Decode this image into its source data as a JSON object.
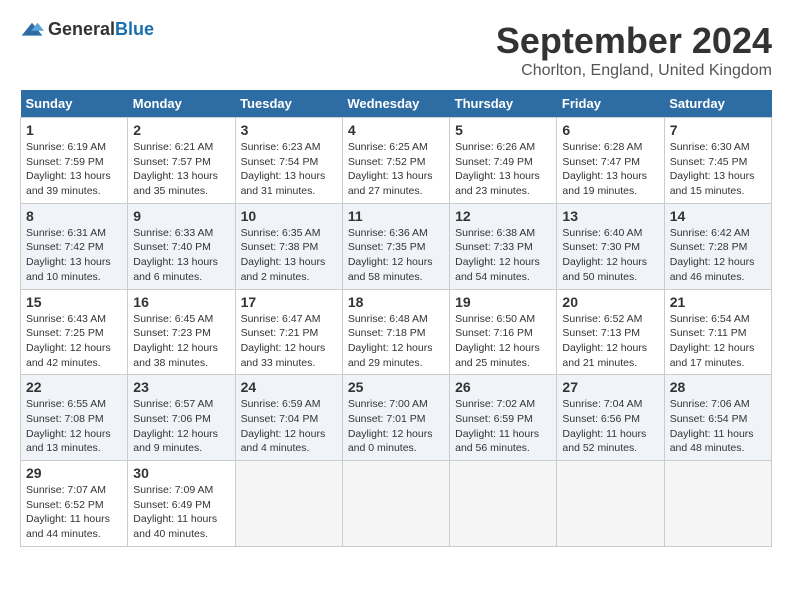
{
  "logo": {
    "general": "General",
    "blue": "Blue"
  },
  "title": "September 2024",
  "location": "Chorlton, England, United Kingdom",
  "headers": [
    "Sunday",
    "Monday",
    "Tuesday",
    "Wednesday",
    "Thursday",
    "Friday",
    "Saturday"
  ],
  "weeks": [
    [
      {
        "day": "1",
        "sunrise": "6:19 AM",
        "sunset": "7:59 PM",
        "daylight": "13 hours and 39 minutes."
      },
      {
        "day": "2",
        "sunrise": "6:21 AM",
        "sunset": "7:57 PM",
        "daylight": "13 hours and 35 minutes."
      },
      {
        "day": "3",
        "sunrise": "6:23 AM",
        "sunset": "7:54 PM",
        "daylight": "13 hours and 31 minutes."
      },
      {
        "day": "4",
        "sunrise": "6:25 AM",
        "sunset": "7:52 PM",
        "daylight": "13 hours and 27 minutes."
      },
      {
        "day": "5",
        "sunrise": "6:26 AM",
        "sunset": "7:49 PM",
        "daylight": "13 hours and 23 minutes."
      },
      {
        "day": "6",
        "sunrise": "6:28 AM",
        "sunset": "7:47 PM",
        "daylight": "13 hours and 19 minutes."
      },
      {
        "day": "7",
        "sunrise": "6:30 AM",
        "sunset": "7:45 PM",
        "daylight": "13 hours and 15 minutes."
      }
    ],
    [
      {
        "day": "8",
        "sunrise": "6:31 AM",
        "sunset": "7:42 PM",
        "daylight": "13 hours and 10 minutes."
      },
      {
        "day": "9",
        "sunrise": "6:33 AM",
        "sunset": "7:40 PM",
        "daylight": "13 hours and 6 minutes."
      },
      {
        "day": "10",
        "sunrise": "6:35 AM",
        "sunset": "7:38 PM",
        "daylight": "13 hours and 2 minutes."
      },
      {
        "day": "11",
        "sunrise": "6:36 AM",
        "sunset": "7:35 PM",
        "daylight": "12 hours and 58 minutes."
      },
      {
        "day": "12",
        "sunrise": "6:38 AM",
        "sunset": "7:33 PM",
        "daylight": "12 hours and 54 minutes."
      },
      {
        "day": "13",
        "sunrise": "6:40 AM",
        "sunset": "7:30 PM",
        "daylight": "12 hours and 50 minutes."
      },
      {
        "day": "14",
        "sunrise": "6:42 AM",
        "sunset": "7:28 PM",
        "daylight": "12 hours and 46 minutes."
      }
    ],
    [
      {
        "day": "15",
        "sunrise": "6:43 AM",
        "sunset": "7:25 PM",
        "daylight": "12 hours and 42 minutes."
      },
      {
        "day": "16",
        "sunrise": "6:45 AM",
        "sunset": "7:23 PM",
        "daylight": "12 hours and 38 minutes."
      },
      {
        "day": "17",
        "sunrise": "6:47 AM",
        "sunset": "7:21 PM",
        "daylight": "12 hours and 33 minutes."
      },
      {
        "day": "18",
        "sunrise": "6:48 AM",
        "sunset": "7:18 PM",
        "daylight": "12 hours and 29 minutes."
      },
      {
        "day": "19",
        "sunrise": "6:50 AM",
        "sunset": "7:16 PM",
        "daylight": "12 hours and 25 minutes."
      },
      {
        "day": "20",
        "sunrise": "6:52 AM",
        "sunset": "7:13 PM",
        "daylight": "12 hours and 21 minutes."
      },
      {
        "day": "21",
        "sunrise": "6:54 AM",
        "sunset": "7:11 PM",
        "daylight": "12 hours and 17 minutes."
      }
    ],
    [
      {
        "day": "22",
        "sunrise": "6:55 AM",
        "sunset": "7:08 PM",
        "daylight": "12 hours and 13 minutes."
      },
      {
        "day": "23",
        "sunrise": "6:57 AM",
        "sunset": "7:06 PM",
        "daylight": "12 hours and 9 minutes."
      },
      {
        "day": "24",
        "sunrise": "6:59 AM",
        "sunset": "7:04 PM",
        "daylight": "12 hours and 4 minutes."
      },
      {
        "day": "25",
        "sunrise": "7:00 AM",
        "sunset": "7:01 PM",
        "daylight": "12 hours and 0 minutes."
      },
      {
        "day": "26",
        "sunrise": "7:02 AM",
        "sunset": "6:59 PM",
        "daylight": "11 hours and 56 minutes."
      },
      {
        "day": "27",
        "sunrise": "7:04 AM",
        "sunset": "6:56 PM",
        "daylight": "11 hours and 52 minutes."
      },
      {
        "day": "28",
        "sunrise": "7:06 AM",
        "sunset": "6:54 PM",
        "daylight": "11 hours and 48 minutes."
      }
    ],
    [
      {
        "day": "29",
        "sunrise": "7:07 AM",
        "sunset": "6:52 PM",
        "daylight": "11 hours and 44 minutes."
      },
      {
        "day": "30",
        "sunrise": "7:09 AM",
        "sunset": "6:49 PM",
        "daylight": "11 hours and 40 minutes."
      },
      null,
      null,
      null,
      null,
      null
    ]
  ]
}
